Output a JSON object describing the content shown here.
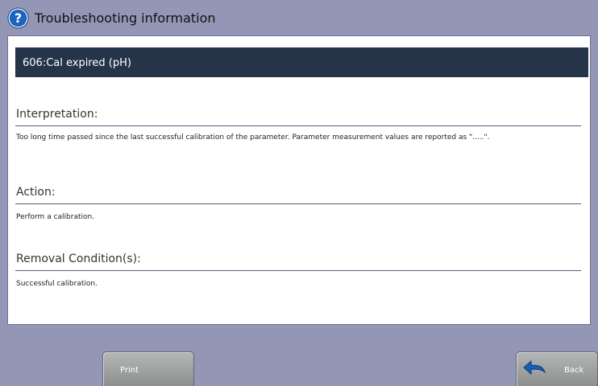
{
  "window": {
    "title": "Troubleshooting information"
  },
  "error": {
    "code_label": "606:Cal expired (pH)"
  },
  "sections": {
    "interpretation": {
      "heading": "Interpretation:",
      "body": "Too long time passed since the last successful calibration of the parameter. Parameter measurement values are reported as \".....\"."
    },
    "action": {
      "heading": "Action:",
      "body": "Perform a calibration."
    },
    "removal": {
      "heading": "Removal Condition(s):",
      "body": "Successful calibration."
    }
  },
  "buttons": {
    "print_label": "Print",
    "back_label": "Back"
  },
  "icons": {
    "help": "help-question-icon",
    "back": "back-arrow-icon"
  },
  "colors": {
    "background": "#9496b6",
    "banner": "#263449",
    "panel": "#ffffff",
    "icon_blue": "#1a62b8"
  }
}
